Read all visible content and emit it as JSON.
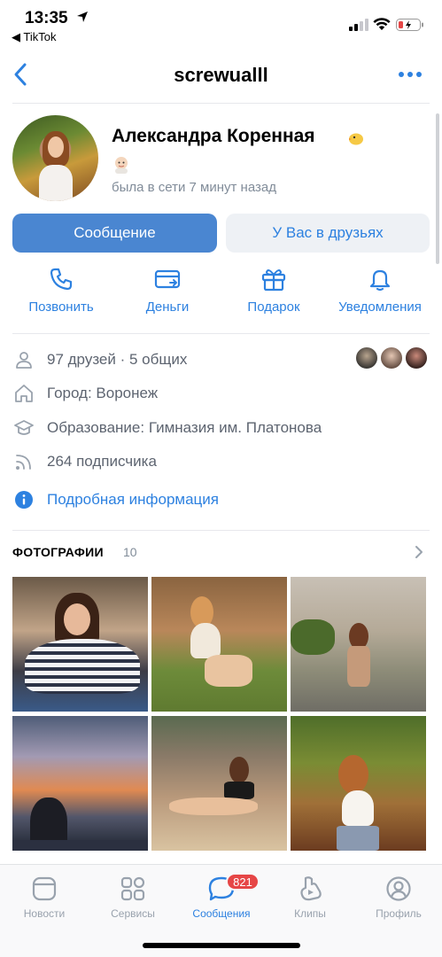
{
  "status_bar": {
    "time": "13:35",
    "back_app": "◀ TikTok"
  },
  "header": {
    "title": "screwualll"
  },
  "profile": {
    "name": "Александра Коренная",
    "last_seen": "была в сети 7 минут назад"
  },
  "buttons": {
    "message": "Сообщение",
    "friends": "У Вас в друзьях"
  },
  "actions": [
    {
      "label": "Позвонить",
      "icon": "phone-icon"
    },
    {
      "label": "Деньги",
      "icon": "money-icon"
    },
    {
      "label": "Подарок",
      "icon": "gift-icon"
    },
    {
      "label": "Уведомления",
      "icon": "bell-icon"
    }
  ],
  "info": {
    "friends": "97 друзей · 5 общих",
    "city": "Город: Воронеж",
    "education": "Образование: Гимназия им. Платонова",
    "followers": "264 подписчика",
    "details": "Подробная информация"
  },
  "photos": {
    "title": "ФОТОГРАФИИ",
    "count": "10"
  },
  "tabbar": {
    "items": [
      {
        "label": "Новости",
        "icon": "news-icon"
      },
      {
        "label": "Сервисы",
        "icon": "services-icon"
      },
      {
        "label": "Сообщения",
        "icon": "messages-icon"
      },
      {
        "label": "Клипы",
        "icon": "clips-icon"
      },
      {
        "label": "Профиль",
        "icon": "profile-icon"
      }
    ],
    "active": "Сообщения",
    "messages_badge": "821"
  },
  "colors": {
    "accent": "#2d81e0",
    "primary_button": "#4a86d1",
    "secondary_button": "#eef1f5",
    "muted_text": "#818c99",
    "badge": "#e64646"
  }
}
